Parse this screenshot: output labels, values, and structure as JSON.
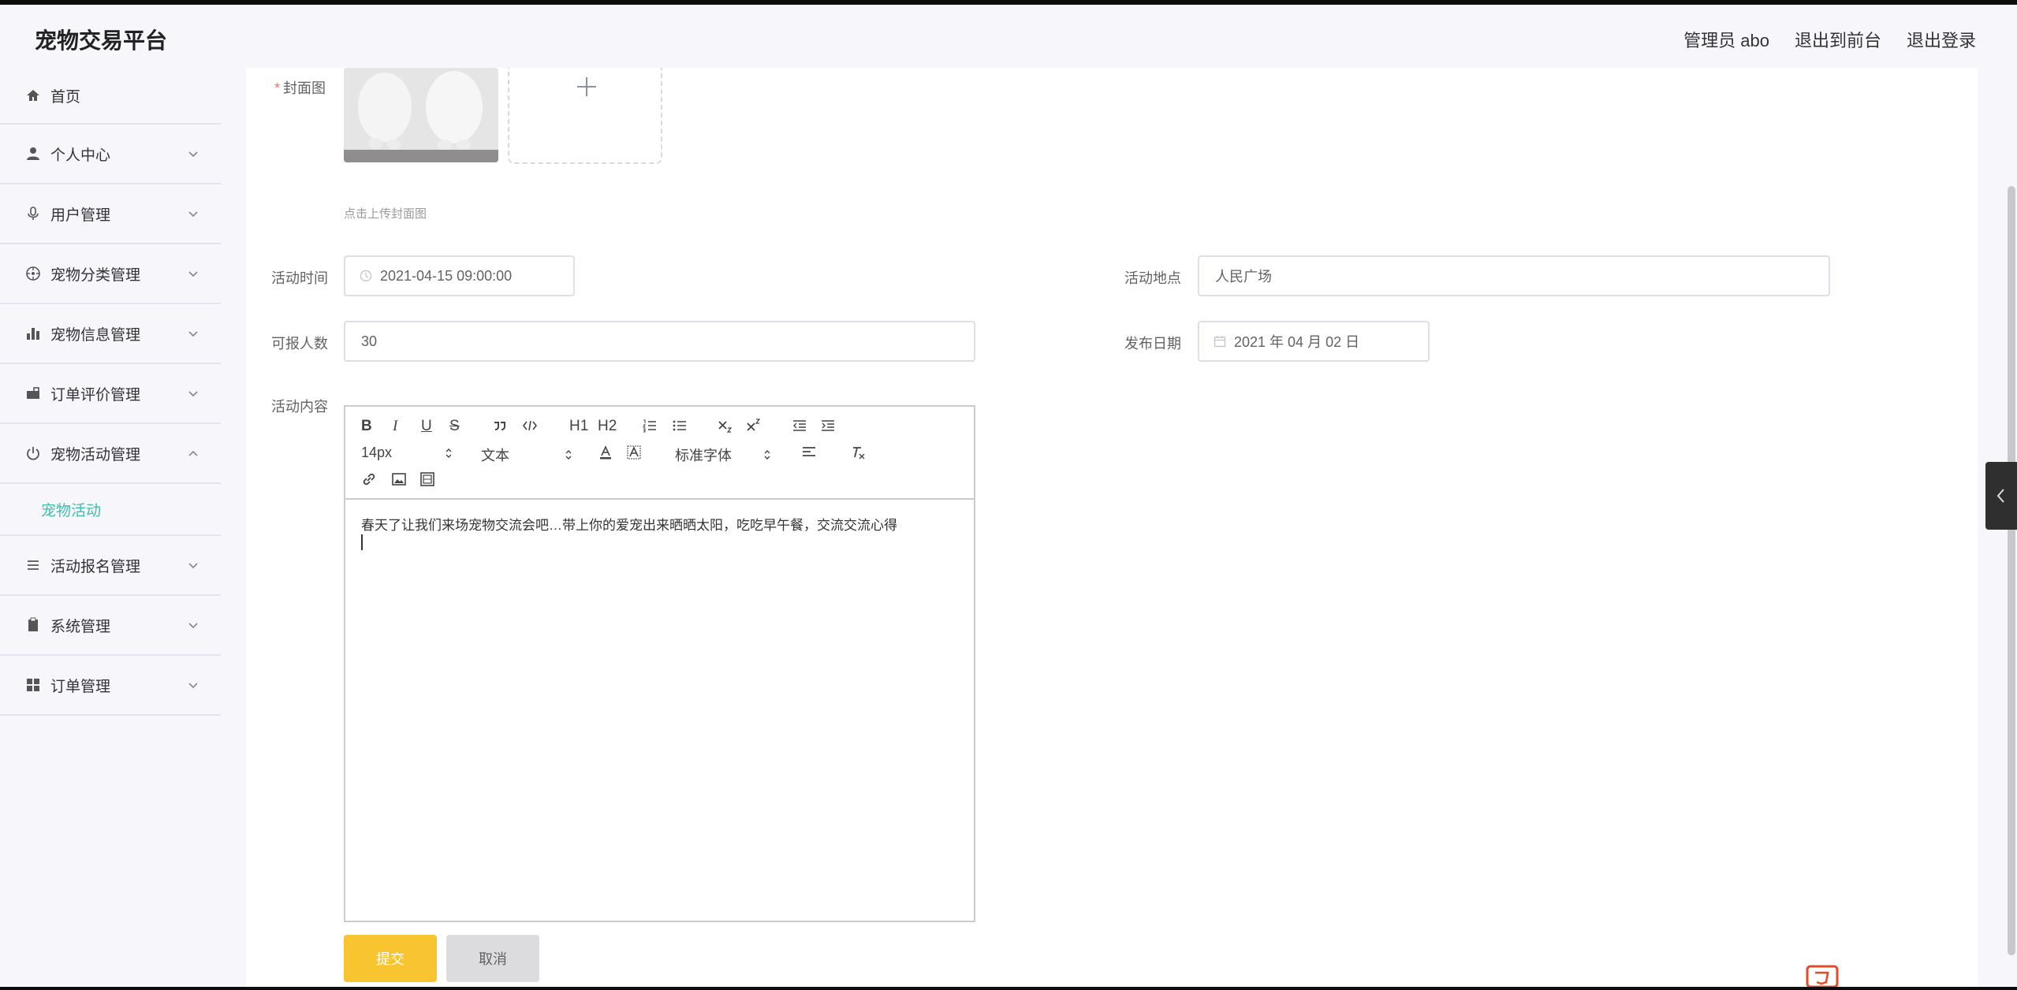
{
  "app": {
    "title": "宠物交易平台"
  },
  "header": {
    "user": "管理员 abo",
    "to_front": "退出到前台",
    "logout": "退出登录"
  },
  "sidebar": {
    "items": [
      {
        "label": "首页",
        "icon": "home-icon"
      },
      {
        "label": "个人中心",
        "icon": "user-icon"
      },
      {
        "label": "用户管理",
        "icon": "mic-icon"
      },
      {
        "label": "宠物分类管理",
        "icon": "compass-icon"
      },
      {
        "label": "宠物信息管理",
        "icon": "bar-chart-icon"
      },
      {
        "label": "订单评价管理",
        "icon": "briefcase-icon"
      },
      {
        "label": "宠物活动管理",
        "icon": "power-icon"
      },
      {
        "label": "活动报名管理",
        "icon": "list-icon"
      },
      {
        "label": "系统管理",
        "icon": "clipboard-icon"
      },
      {
        "label": "订单管理",
        "icon": "grid-icon"
      }
    ],
    "active_sub": "宠物活动"
  },
  "form": {
    "cover_label": "封面图",
    "cover_hint": "点击上传封面图",
    "time_label": "活动时间",
    "time_value": "2021-04-15 09:00:00",
    "place_label": "活动地点",
    "place_value": "人民广场",
    "count_label": "可报人数",
    "count_value": "30",
    "date_label": "发布日期",
    "date_value": "2021 年 04 月 02 日",
    "content_label": "活动内容",
    "content_text": "春天了让我们来场宠物交流会吧…带上你的爱宠出来晒晒太阳，吃吃早午餐，交流交流心得",
    "submit": "提交",
    "cancel": "取消"
  },
  "editor": {
    "size": "14px",
    "header": "文本",
    "font": "标准字体",
    "buttons": {
      "bold": "B",
      "italic": "I",
      "underline": "U",
      "strike": "S",
      "h1": "H1",
      "h2": "H2"
    }
  },
  "colors": {
    "accent": "#3ebfab",
    "submit": "#f8c530",
    "required": "#f56c6c"
  }
}
